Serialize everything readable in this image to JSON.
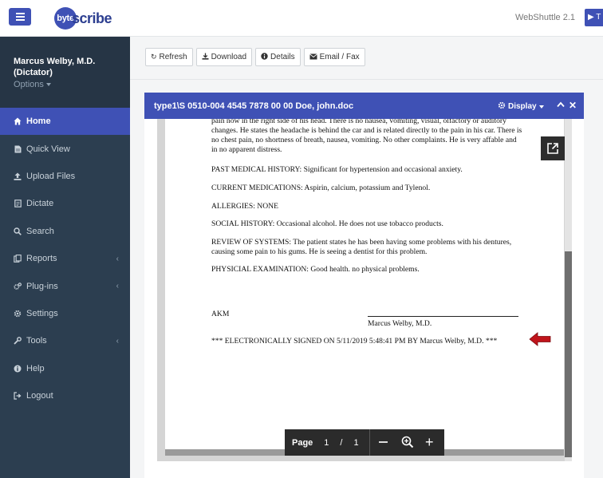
{
  "app": {
    "logo_mark": "byte",
    "logo_text": "scribe",
    "version": "WebShuttle 2.1",
    "top_right_label": "T"
  },
  "user": {
    "name": "Marcus Welby, M.D.",
    "role": "(Dictator)",
    "options_label": "Options"
  },
  "nav": [
    {
      "label": "Home",
      "icon": "home-icon",
      "active": true
    },
    {
      "label": "Quick View",
      "icon": "file-icon"
    },
    {
      "label": "Upload Files",
      "icon": "upload-icon"
    },
    {
      "label": "Dictate",
      "icon": "document-icon"
    },
    {
      "label": "Search",
      "icon": "search-icon"
    },
    {
      "label": "Reports",
      "icon": "reports-icon",
      "has_submenu": true
    },
    {
      "label": "Plug-ins",
      "icon": "gears-icon",
      "has_submenu": true
    },
    {
      "label": "Settings",
      "icon": "gear-icon"
    },
    {
      "label": "Tools",
      "icon": "wrench-icon",
      "has_submenu": true
    },
    {
      "label": "Help",
      "icon": "info-icon"
    },
    {
      "label": "Logout",
      "icon": "logout-icon"
    }
  ],
  "toolbar": {
    "refresh": "Refresh",
    "download": "Download",
    "details": "Details",
    "email_fax": "Email / Fax"
  },
  "document": {
    "title": "type1\\S 0510-004 4545 7878 00 00 Doe, john.doc",
    "display_label": "Display",
    "top_cut_line": "pain now in the right side of his head. There is no nausea, vomiting, visual, olfactory or auditory",
    "hpi_rest": "changes. He states the headache is behind the car and is related directly to the pain in his car. There is no chest pain, no shortness of breath, nausea, vomiting. No other complaints. He is very affable and in no apparent distress.",
    "pmh": "PAST MEDICAL HISTORY:  Significant for hypertension and occasional anxiety.",
    "meds": "CURRENT MEDICATIONS:  Aspirin, calcium, potassium and Tylenol.",
    "allergies": "ALLERGIES: NONE",
    "social": "SOCIAL HISTORY:  Occasional alcohol. He does not use tobacco products.",
    "ros": "REVIEW OF SYSTEMS:  The patient states he has been having some problems with his dentures, causing some pain to his gums. He is seeing a dentist for this problem.",
    "exam": "PHYSICIAL EXAMINATION:  Good health. no physical problems.",
    "initials": "AKM",
    "signature_name": "Marcus Welby, M.D.",
    "signed_line": "*** ELECTRONICALLY SIGNED ON 5/11/2019 5:48:41 PM BY Marcus Welby, M.D. ***"
  },
  "pager": {
    "label": "Page",
    "current": "1",
    "separator": "/",
    "total": "1"
  },
  "colors": {
    "primary": "#3f51b5",
    "sidebar": "#2c3e50",
    "arrow": "#c0141b"
  }
}
